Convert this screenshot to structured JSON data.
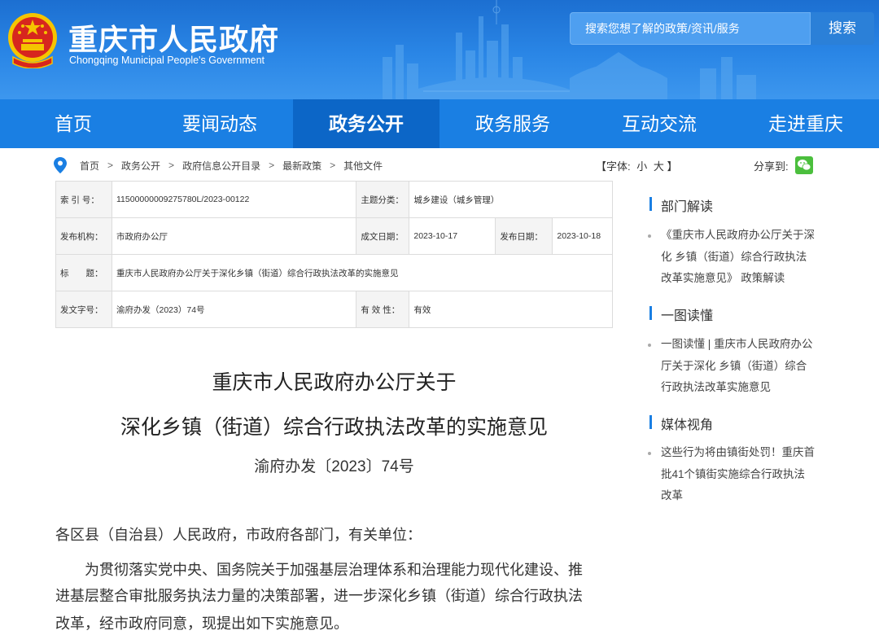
{
  "header": {
    "title": "重庆市人民政府",
    "subtitle": "Chongqing Municipal People's Government",
    "search_placeholder": "搜索您想了解的政策/资讯/服务",
    "search_button": "搜索"
  },
  "nav": [
    "首页",
    "要闻动态",
    "政务公开",
    "政务服务",
    "互动交流",
    "走进重庆"
  ],
  "breadcrumb": [
    "首页",
    "政务公开",
    "政府信息公开目录",
    "最新政策",
    "其他文件"
  ],
  "font_size": {
    "label": "【字体:",
    "small": "小",
    "large": "大",
    "close": "】"
  },
  "share_label": "分享到:",
  "info": {
    "index_label": "索 引 号：",
    "index_value": "11500000009275780L/2023-00122",
    "topic_label": "主题分类：",
    "topic_value": "城乡建设（城乡管理）",
    "publisher_label": "发布机构：",
    "publisher_value": "市政府办公厅",
    "written_label": "成文日期：",
    "written_value": "2023-10-17",
    "published_label": "发布日期：",
    "published_value": "2023-10-18",
    "title_label": "标　　题：",
    "title_value": "重庆市人民政府办公厅关于深化乡镇（街道）综合行政执法改革的实施意见",
    "docno_label": "发文字号：",
    "docno_value": "渝府办发（2023）74号",
    "validity_label": "有 效 性：",
    "validity_value": "有效"
  },
  "article": {
    "title_line1": "重庆市人民政府办公厅关于",
    "title_line2": "深化乡镇（街道）综合行政执法改革的实施意见",
    "doc_no": "渝府办发〔2023〕74号",
    "salutation": "各区县（自治县）人民政府，市政府各部门，有关单位：",
    "body_line1": "为贯彻落实党中央、国务院关于加强基层治理体系和治理能力现代化建设、推",
    "body_line2": "进基层整合审批服务执法力量的决策部署，进一步深化乡镇（街道）综合行政执法",
    "body_line3": "改革，经市政府同意，现提出如下实施意见。"
  },
  "sidebar": [
    {
      "heading": "部门解读",
      "lines": [
        "《重庆市人民政府办公厅关于深",
        "化 乡镇（街道）综合行政执法",
        "改革实施意见》 政策解读"
      ]
    },
    {
      "heading": "一图读懂",
      "lines": [
        "一图读懂 | 重庆市人民政府办公",
        "厅关于深化 乡镇（街道）综合",
        "行政执法改革实施意见"
      ]
    },
    {
      "heading": "媒体视角",
      "lines": [
        "这些行为将由镇街处罚！重庆首",
        "批41个镇街实施综合行政执法",
        "改革"
      ]
    }
  ],
  "colors": {
    "header_blue": "#2a86e6",
    "nav_blue": "#1a7fe3",
    "nav_active": "#0c66c7",
    "emblem_red": "#d7261e",
    "emblem_gold": "#f5c400"
  }
}
